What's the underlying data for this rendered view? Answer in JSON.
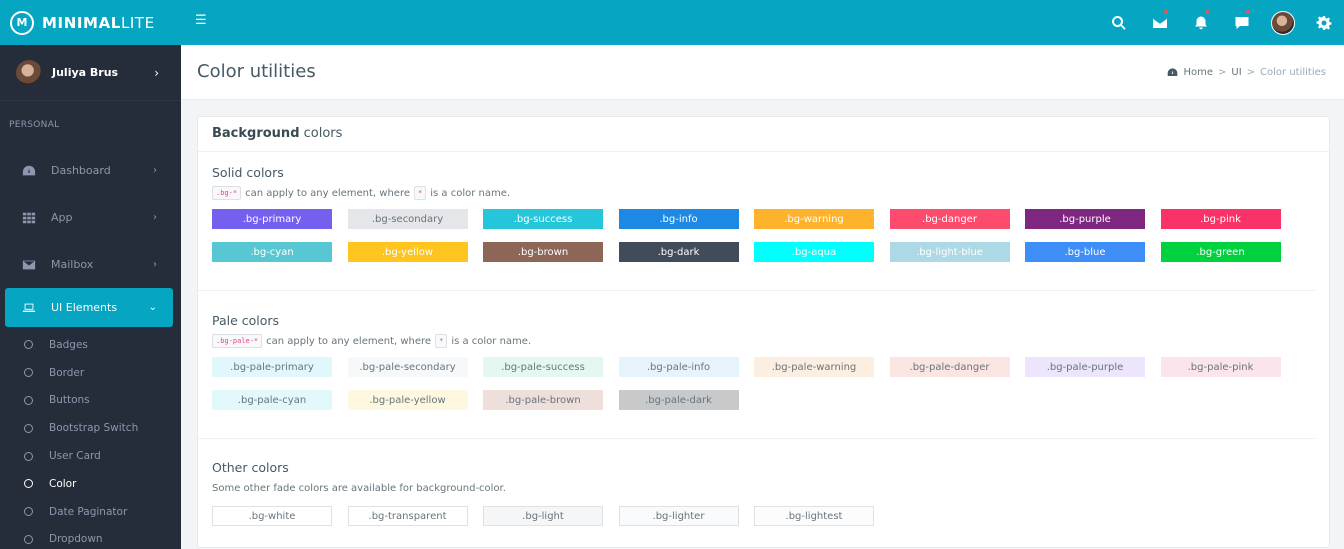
{
  "brand": {
    "logo_letter": "M",
    "name_bold": "MINIMAL",
    "name_light": "LITE"
  },
  "topbar": {
    "icons": [
      "search-icon",
      "mail-icon",
      "bell-icon",
      "chat-icon",
      "avatar",
      "gear-icon"
    ]
  },
  "sidebar": {
    "user": {
      "name": "Juliya Brus"
    },
    "section_header": "PERSONAL",
    "items": [
      {
        "label": "Dashboard",
        "icon": "dashboard-icon"
      },
      {
        "label": "App",
        "icon": "grid-icon"
      },
      {
        "label": "Mailbox",
        "icon": "mail-icon"
      },
      {
        "label": "UI Elements",
        "icon": "laptop-icon",
        "active": true
      }
    ],
    "sub_items": [
      {
        "label": "Badges"
      },
      {
        "label": "Border"
      },
      {
        "label": "Buttons"
      },
      {
        "label": "Bootstrap Switch"
      },
      {
        "label": "User Card"
      },
      {
        "label": "Color",
        "active": true
      },
      {
        "label": "Date Paginator"
      },
      {
        "label": "Dropdown"
      }
    ]
  },
  "page": {
    "title": "Color utilities",
    "breadcrumb": {
      "home": "Home",
      "ui": "UI",
      "current": "Color utilities"
    }
  },
  "card": {
    "title_bold": "Background",
    "title_rest": " colors",
    "solid": {
      "title": "Solid colors",
      "code1": ".bg-*",
      "text1": "can apply to any element, where",
      "code2": "*",
      "text2": "is a color name.",
      "swatches": [
        {
          "label": ".bg-primary",
          "color": "#7460ee"
        },
        {
          "label": ".bg-secondary",
          "color": "#e4e6e9",
          "text": "#67757c"
        },
        {
          "label": ".bg-success",
          "color": "#26c6da"
        },
        {
          "label": ".bg-info",
          "color": "#1e88e5"
        },
        {
          "label": ".bg-warning",
          "color": "#ffb22b"
        },
        {
          "label": ".bg-danger",
          "color": "#fc4b6c"
        },
        {
          "label": ".bg-purple",
          "color": "#7d2781"
        },
        {
          "label": ".bg-pink",
          "color": "#fa3267"
        },
        {
          "label": ".bg-cyan",
          "color": "#57c7d4"
        },
        {
          "label": ".bg-yellow",
          "color": "#ffc41d"
        },
        {
          "label": ".bg-brown",
          "color": "#8d6658"
        },
        {
          "label": ".bg-dark",
          "color": "#414b5a"
        },
        {
          "label": ".bg-aqua",
          "color": "#00ffff"
        },
        {
          "label": ".bg-light-blue",
          "color": "#add8e6"
        },
        {
          "label": ".bg-blue",
          "color": "#3e8ef7"
        },
        {
          "label": ".bg-green",
          "color": "#00d13f"
        }
      ]
    },
    "pale": {
      "title": "Pale colors",
      "code1": ".bg-pale-*",
      "text1": "can apply to any element, where",
      "code2": "*",
      "text2": "is a color name.",
      "swatches": [
        {
          "label": ".bg-pale-primary",
          "color": "#e1f7fb"
        },
        {
          "label": ".bg-pale-secondary",
          "color": "#f7f8f9"
        },
        {
          "label": ".bg-pale-success",
          "color": "#e5f8f0"
        },
        {
          "label": ".bg-pale-info",
          "color": "#e6f3fb"
        },
        {
          "label": ".bg-pale-warning",
          "color": "#fdeee2"
        },
        {
          "label": ".bg-pale-danger",
          "color": "#fbe5e3"
        },
        {
          "label": ".bg-pale-purple",
          "color": "#ece5fb"
        },
        {
          "label": ".bg-pale-pink",
          "color": "#fbe4ec"
        },
        {
          "label": ".bg-pale-cyan",
          "color": "#e2f8fb"
        },
        {
          "label": ".bg-pale-yellow",
          "color": "#fff8e0"
        },
        {
          "label": ".bg-pale-brown",
          "color": "#eedfdb"
        },
        {
          "label": ".bg-pale-dark",
          "color": "#c7c9cb"
        }
      ]
    },
    "other": {
      "title": "Other colors",
      "desc": "Some other fade colors are available for background-color.",
      "swatches": [
        {
          "label": ".bg-white",
          "color": "#ffffff"
        },
        {
          "label": ".bg-transparent",
          "color": "#ffffff"
        },
        {
          "label": ".bg-light",
          "color": "#f5f6f7"
        },
        {
          "label": ".bg-lighter",
          "color": "#f9fafb"
        },
        {
          "label": ".bg-lightest",
          "color": "#fcfcfd"
        }
      ]
    }
  }
}
